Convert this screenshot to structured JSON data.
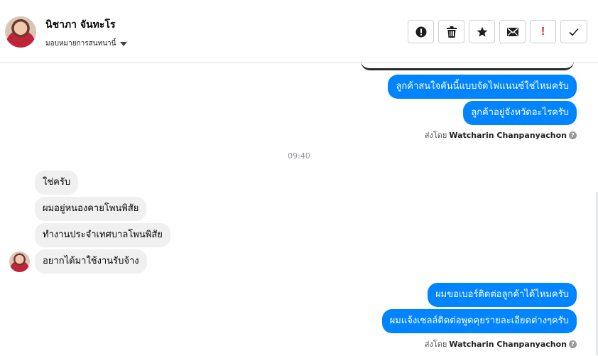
{
  "header": {
    "name": "นิชาภา จันทะโร",
    "assign_label": "มอบหมายการสนทนานี้"
  },
  "messages": {
    "m1": "ลูกค้าสนใจคันนี้แบบจัดไฟแนนซ์ใช่ไหมครับ",
    "m2": "ลูกค้าอยู่จังหวัดอะไรครับ",
    "sent_prefix": "ส่งโดย",
    "sender": "Watcharin Chanpanyachon",
    "time": "09:40",
    "r1": "ใช่ครับ",
    "r2": "ผมอยู่หนองคายโพนพิสัย",
    "r3": "ทำงานประจำเทศบาลโพนพิสัย",
    "r4": "อยากได้มาใช้งานรับจ้าง",
    "m3": "ผมขอเบอร์ติดต่อลูกค้าได้ไหมครับ",
    "m4": "ผมแจ้งเซลล์ติดต่อพูดคุยรายละเอียดต่างๆครับ",
    "qmark": "?"
  },
  "colors": {
    "outgoing": "#0084ff",
    "incoming": "#f0f0f0",
    "alert": "#e02020"
  },
  "icons": [
    "spam-icon",
    "trash-icon",
    "star-icon",
    "mail-icon",
    "exclamation-icon",
    "check-icon"
  ],
  "toolbar": {
    "alert_glyph": "!"
  }
}
